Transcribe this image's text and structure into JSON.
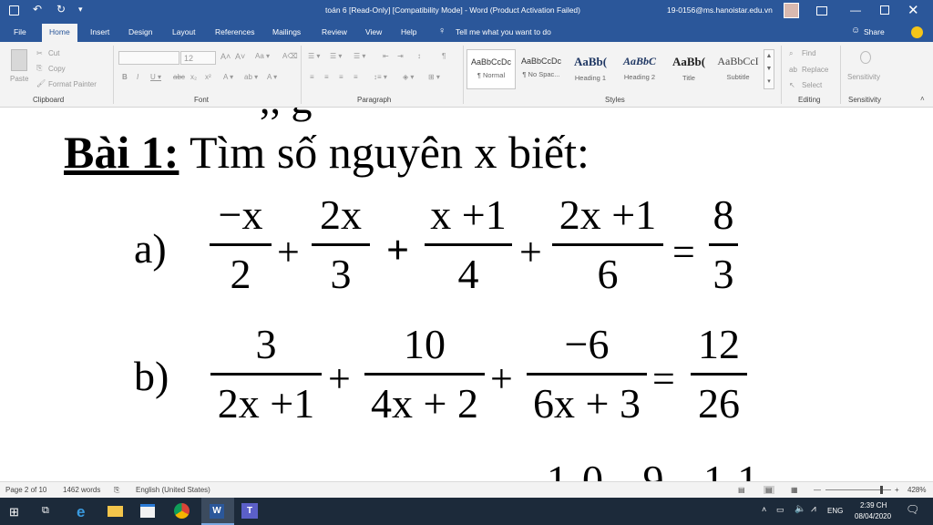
{
  "title_bar": {
    "document_title": "toán 6 [Read-Only] [Compatibility Mode]  -  Word (Product Activation Failed)",
    "account": "19-0156@ms.hanoistar.edu.vn"
  },
  "ribbon_tabs": [
    "File",
    "Home",
    "Insert",
    "Design",
    "Layout",
    "References",
    "Mailings",
    "Review",
    "View",
    "Help"
  ],
  "tell_me": "Tell me what you want to do",
  "share_label": "Share",
  "clipboard": {
    "paste": "Paste",
    "cut": "Cut",
    "copy": "Copy",
    "format_painter": "Format Painter",
    "group": "Clipboard"
  },
  "font": {
    "size": "12",
    "group": "Font"
  },
  "paragraph": {
    "group": "Paragraph"
  },
  "styles": {
    "group": "Styles",
    "items": [
      {
        "sample": "AaBbCcDc",
        "name": "¶ Normal"
      },
      {
        "sample": "AaBbCcDc",
        "name": "¶ No Spac..."
      },
      {
        "sample": "AaBb(",
        "name": "Heading 1"
      },
      {
        "sample": "AaBbC",
        "name": "Heading 2"
      },
      {
        "sample": "AaBb(",
        "name": "Title"
      },
      {
        "sample": "AaBbCcI",
        "name": "Subtitle"
      }
    ]
  },
  "editing": {
    "find": "Find",
    "replace": "Replace",
    "select": "Select",
    "group": "Editing"
  },
  "sensitivity": {
    "label": "Sensitivity",
    "group": "Sensitivity"
  },
  "document": {
    "heading_bold": "Bài 1:",
    "heading_rest": " Tìm số nguyên x biết:",
    "a_label": "a)",
    "b_label": "b)",
    "eq_a": {
      "t1n": "−x",
      "t1d": "2",
      "op1": "+",
      "t2n": "2x",
      "t2d": "3",
      "op2": "+",
      "t3n": "x +1",
      "t3d": "4",
      "op3": "+",
      "t4n": "2x +1",
      "t4d": "6",
      "eq": "=",
      "rn": "8",
      "rd": "3"
    },
    "eq_b": {
      "t1n": "3",
      "t1d": "2x +1",
      "op1": "+",
      "t2n": "10",
      "t2d": "4x + 2",
      "op2": "+",
      "t3n": "−6",
      "t3d": "6x + 3",
      "eq": "=",
      "rn": "12",
      "rd": "26"
    }
  },
  "status_bar": {
    "page": "Page 2 of 10",
    "words": "1462 words",
    "language": "English (United States)",
    "zoom": "428%"
  },
  "taskbar": {
    "time": "2:39 CH",
    "date": "08/04/2020",
    "lang": "ENG"
  },
  "colors": {
    "word_blue": "#2b579a",
    "taskbar": "#1c2a3a"
  }
}
